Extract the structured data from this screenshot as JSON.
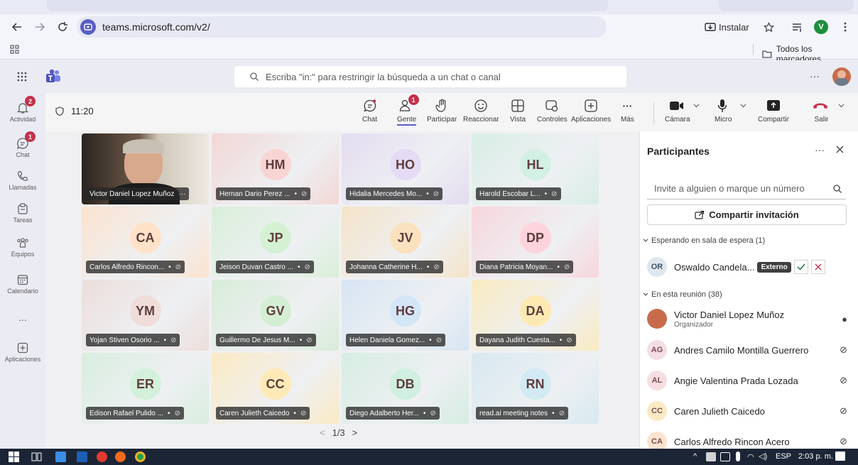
{
  "browser": {
    "url": "teams.microsoft.com/v2/",
    "install_label": "Instalar",
    "profile_initial": "V",
    "bookmarks_all": "Todos los marcadores"
  },
  "teams": {
    "search_placeholder": "Escriba \"in:\" para restringir la búsqueda a un chat o canal",
    "more": "···"
  },
  "rail": [
    {
      "label": "Actividad",
      "badge": "2"
    },
    {
      "label": "Chat",
      "badge": "1"
    },
    {
      "label": "Llamadas",
      "badge": ""
    },
    {
      "label": "Tareas",
      "badge": ""
    },
    {
      "label": "Equipos",
      "badge": ""
    },
    {
      "label": "Calendario",
      "badge": ""
    },
    {
      "label": "...",
      "badge": ""
    },
    {
      "label": "Aplicaciones",
      "badge": ""
    }
  ],
  "meeting": {
    "timer": "11:20",
    "controls": {
      "chat": "Chat",
      "people": "Gente",
      "people_badge": "1",
      "raise": "Participar",
      "react": "Reaccionar",
      "view": "Vista",
      "controls": "Controles",
      "apps": "Aplicaciones",
      "more": "Más",
      "camera": "Cámara",
      "mic": "Micro",
      "share": "Compartir",
      "leave": "Salir"
    },
    "tiles": [
      {
        "initials": "",
        "name": "Victor Daniel Lopez Muñoz",
        "video": true,
        "color": "#000000"
      },
      {
        "initials": "HM",
        "name": "Hernan Dario Perez ...",
        "color": "#f2d7d5"
      },
      {
        "initials": "HO",
        "name": "Hidalia Mercedes Mo...",
        "color": "#e4dcf0"
      },
      {
        "initials": "HL",
        "name": "Harold Escobar L...",
        "color": "#d8eee6"
      },
      {
        "initials": "CA",
        "name": "Carlos Alfredo Rincon...",
        "color": "#fbe3cf"
      },
      {
        "initials": "JP",
        "name": "Jeison Duvan Castro ...",
        "color": "#d9efd9"
      },
      {
        "initials": "JV",
        "name": "Johanna Catherine H...",
        "color": "#f5e3c8"
      },
      {
        "initials": "DP",
        "name": "Diana Patricia Moyan...",
        "color": "#f6d6dc"
      },
      {
        "initials": "YM",
        "name": "Yojan Stiven Osorio ...",
        "color": "#ecdedb"
      },
      {
        "initials": "GV",
        "name": "Guillermo De Jesus M...",
        "color": "#d8ecd8"
      },
      {
        "initials": "HG",
        "name": "Helen Daniela Gomez...",
        "color": "#d7e5f3"
      },
      {
        "initials": "DA",
        "name": "Dayana Judith Cuesta...",
        "color": "#f9eac0"
      },
      {
        "initials": "ER",
        "name": "Edison Rafael Pulido ...",
        "color": "#d8eede"
      },
      {
        "initials": "CC",
        "name": "Caren Julieth Caicedo",
        "color": "#fbeac3"
      },
      {
        "initials": "DB",
        "name": "Diego Adalberto Her...",
        "color": "#d5ede2"
      },
      {
        "initials": "RN",
        "name": "read.ai meeting notes",
        "color": "#d6e9f0"
      }
    ],
    "pager": "1/3"
  },
  "panel": {
    "title": "Participantes",
    "invite_placeholder": "Invite a alguien o marque un número",
    "share_invite": "Compartir invitación",
    "waiting_section": "Esperando en sala de espera (1)",
    "waiting": {
      "initials": "OR",
      "name": "Oswaldo Candela...",
      "tag": "Externo"
    },
    "in_meeting_section": "En esta reunión (38)",
    "participants": [
      {
        "initials": "",
        "name": "Victor Daniel Lopez Muñoz",
        "role": "Organizador",
        "color": "#c86b4a"
      },
      {
        "initials": "AG",
        "name": "Andres Camilo Montilla Guerrero",
        "role": "",
        "color": "#f4dde3"
      },
      {
        "initials": "AL",
        "name": "Angie Valentina Prada Lozada",
        "role": "",
        "color": "#f6dde1"
      },
      {
        "initials": "CC",
        "name": "Caren Julieth Caicedo",
        "role": "",
        "color": "#fbeac3"
      },
      {
        "initials": "CA",
        "name": "Carlos Alfredo Rincon Acero",
        "role": "",
        "color": "#fbe3cf"
      }
    ]
  },
  "taskbar": {
    "lang": "ESP",
    "time": "2:03 p. m."
  }
}
